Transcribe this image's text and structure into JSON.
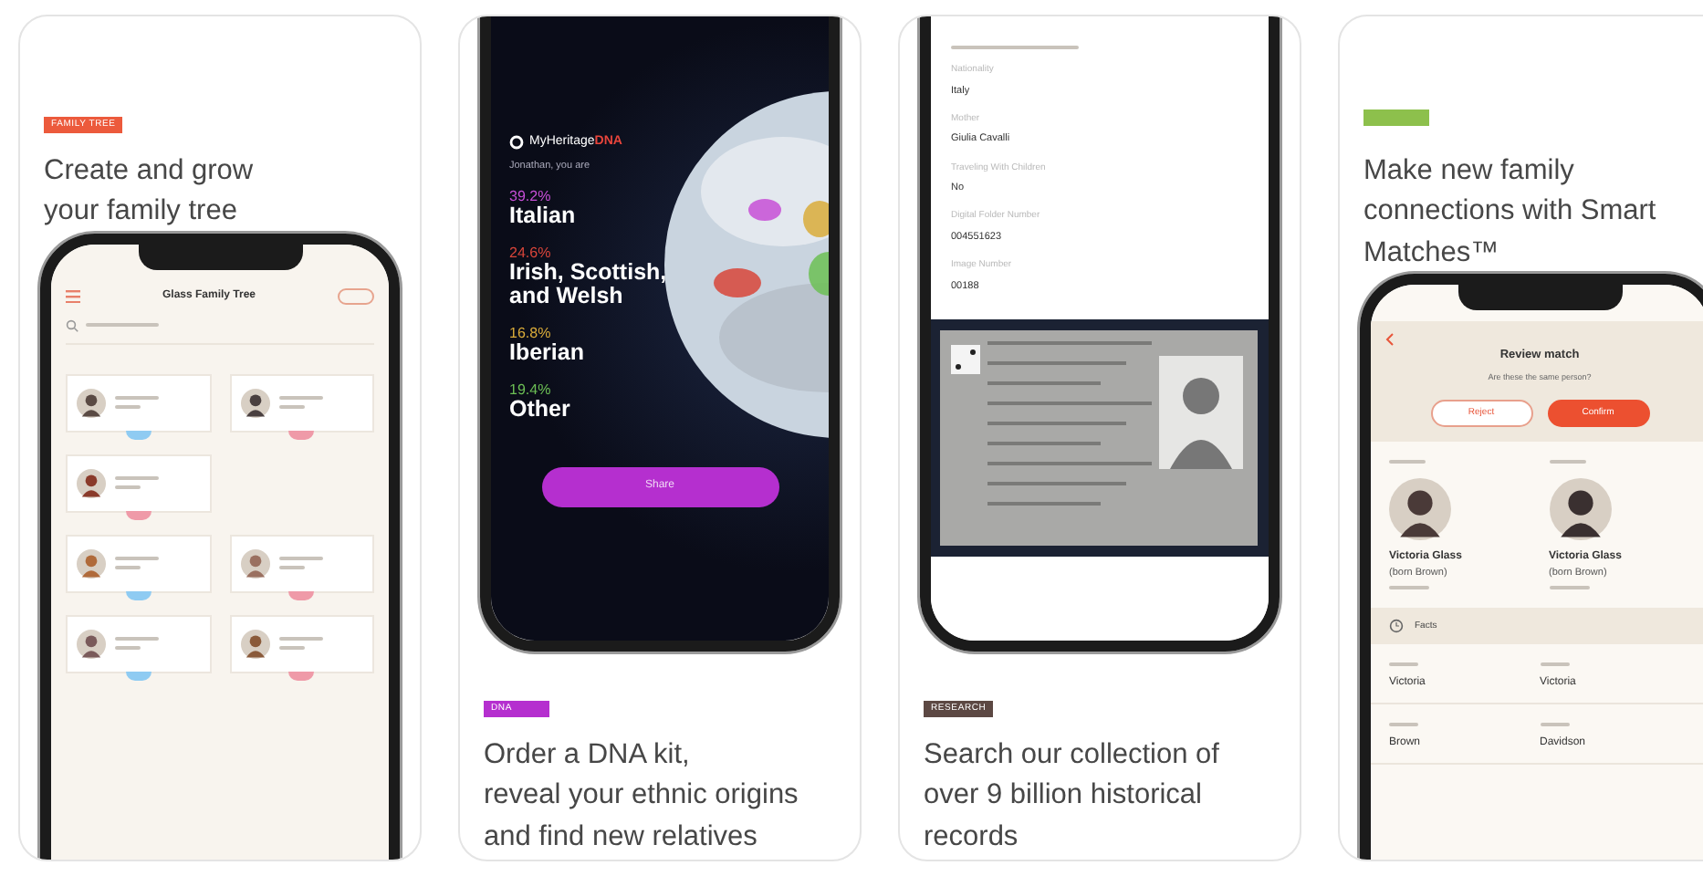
{
  "panels": [
    {
      "kind": "text-top",
      "tag": {
        "label": "FAMILY TREE",
        "color": "#ec5a3c"
      },
      "caption": "Create and grow\nyour family tree",
      "screen": {
        "kind": "tree",
        "title": "Glass Family Tree",
        "rows": [
          [
            {
              "color": "#8fcbf2"
            },
            {
              "color": "#ef9aa8"
            }
          ],
          [
            {
              "color": "#ef9aa8"
            }
          ],
          [
            {
              "color": "#8fcbf2"
            },
            {
              "color": "#ef9aa8"
            }
          ],
          [
            {
              "color": "#8fcbf2"
            },
            {
              "color": "#ef9aa8"
            }
          ]
        ]
      }
    },
    {
      "kind": "text-bottom",
      "tag": {
        "label": "DNA",
        "color": "#b52fcf"
      },
      "caption": "Order a DNA kit,\nreveal your ethnic origins\nand find new relatives",
      "screen": {
        "kind": "dna",
        "brand": "MyHeritage",
        "brand_accent": "DNA",
        "greeting": "Jonathan, you are",
        "ethnicities": [
          {
            "percent": "39.2%",
            "name": "Italian",
            "color": "#c74fd6"
          },
          {
            "percent": "24.6%",
            "name": "Irish, Scottish,\nand Welsh",
            "color": "#d8453a"
          },
          {
            "percent": "16.8%",
            "name": "Iberian",
            "color": "#d9ab3a"
          },
          {
            "percent": "19.4%",
            "name": "Other",
            "color": "#6cbf55"
          }
        ],
        "button": "Share"
      }
    },
    {
      "kind": "text-bottom",
      "tag": {
        "label": "RESEARCH",
        "color": "#5c4843"
      },
      "caption": "Search our collection of\nover 9 billion historical\nrecords",
      "screen": {
        "kind": "record",
        "fields": [
          {
            "label": "Nationality",
            "value": "Italy"
          },
          {
            "label": "Mother",
            "value": "Giulia Cavalli"
          },
          {
            "label": "Traveling With Children",
            "value": "No"
          },
          {
            "label": "Digital Folder Number",
            "value": "004551623"
          },
          {
            "label": "Image Number",
            "value": "00188"
          }
        ]
      }
    },
    {
      "kind": "text-top",
      "tag": {
        "color": "#8dc04c"
      },
      "caption": "Make new family\nconnections with Smart\nMatches™",
      "screen": {
        "kind": "match",
        "title": "Review match",
        "subtitle": "Are these the same person?",
        "reject": "Reject",
        "confirm": "Confirm",
        "people": [
          {
            "name": "Victoria Glass",
            "born": "(born Brown)"
          },
          {
            "name": "Victoria Glass",
            "born": "(born Brown)"
          }
        ],
        "facts": "Facts",
        "rows": [
          {
            "values": [
              "Victoria",
              "Victoria"
            ]
          },
          {
            "values": [
              "Brown",
              "Davidson"
            ]
          }
        ]
      }
    }
  ]
}
